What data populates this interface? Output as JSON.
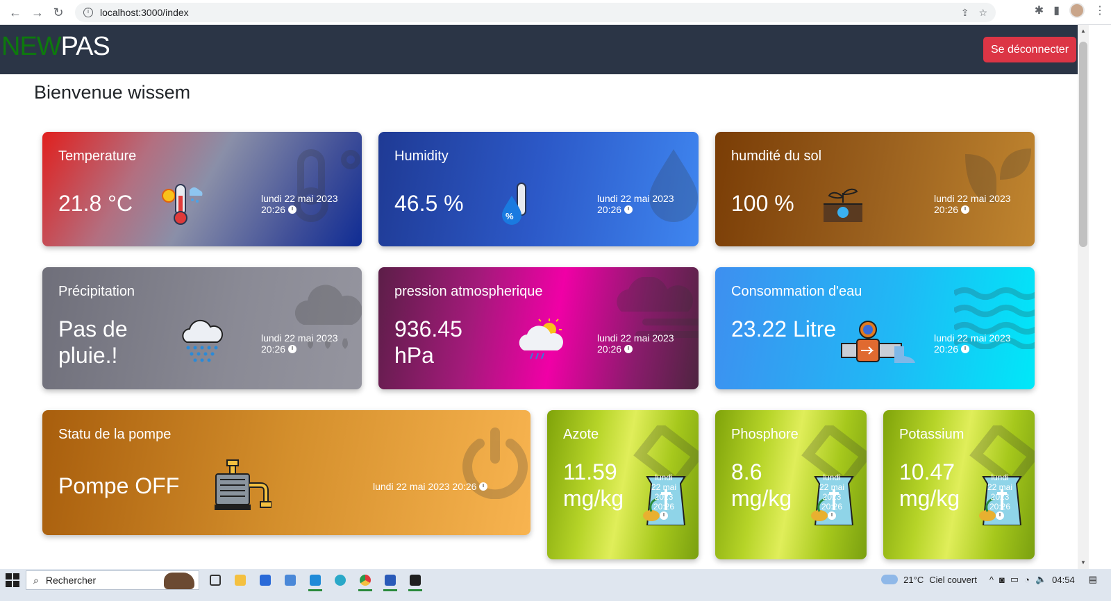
{
  "browser": {
    "url": "localhost:3000/index",
    "icons": [
      "back-arrow-icon",
      "forward-arrow-icon",
      "reload-icon",
      "info-icon",
      "share-icon",
      "star-icon",
      "extensions-icon",
      "side-panel-icon",
      "profile-avatar",
      "more-menu-icon"
    ]
  },
  "header": {
    "logo_part1": "NEW",
    "logo_part2": "PAS",
    "logo_part1_color": "#0d7a0d",
    "logout_label": "Se déconnecter",
    "logout_color": "#dc3545"
  },
  "welcome": "Bienvenue wissem",
  "cards": {
    "temperature": {
      "title": "Temperature",
      "value": "21.8 °C",
      "date": "lundi 22 mai 2023",
      "time": "20:26",
      "icon": "thermometer-sun-icon",
      "bg_icon": "thermometer-icon"
    },
    "humidity": {
      "title": "Humidity",
      "value": "46.5 %",
      "date": "lundi 22 mai 2023",
      "time": "20:26",
      "icon": "humidity-drop-icon",
      "bg_icon": "droplet-icon"
    },
    "soil": {
      "title": "humdité du sol",
      "value": "100 %",
      "date": "lundi 22 mai 2023",
      "time": "20:26",
      "icon": "plant-soil-icon",
      "bg_icon": "seedling-icon"
    },
    "precipitation": {
      "title": "Précipitation",
      "value_line1": "Pas de",
      "value_line2": "pluie.!",
      "date": "lundi 22 mai 2023",
      "time": "20:26",
      "icon": "rain-cloud-icon",
      "bg_icon": "cloud-rain-icon"
    },
    "pressure": {
      "title": "pression atmospherique",
      "value_line1": "936.45",
      "value_line2": "hPa",
      "date": "lundi 22 mai 2023",
      "time": "20:26",
      "icon": "cloud-sun-rain-icon",
      "bg_icon": "smog-icon"
    },
    "water": {
      "title": "Consommation d'eau",
      "value": "23.22 Litre",
      "date": "lundi 22 mai 2023",
      "time": "20:26",
      "icon": "water-meter-pipe-icon",
      "bg_icon": "water-waves-icon"
    },
    "pump": {
      "title": "Statu de la pompe",
      "value": "Pompe OFF",
      "date": "lundi 22 mai 2023 20:26",
      "icon": "water-pump-icon",
      "bg_icon": "power-icon"
    },
    "azote": {
      "title": "Azote",
      "value_line1": "11.59",
      "value_line2": "mg/kg",
      "date_l1": "lundi",
      "date_l2": "22 mai",
      "date_l3": "2023",
      "date_l4": "20:26",
      "icon": "fertilizer-bag-icon",
      "bg_icon": "flask-icon"
    },
    "phosphore": {
      "title": "Phosphore",
      "value_line1": "8.6",
      "value_line2": "mg/kg",
      "date_l1": "lundi",
      "date_l2": "22 mai",
      "date_l3": "2023",
      "date_l4": "20:26",
      "icon": "fertilizer-bag-icon",
      "bg_icon": "flask-icon"
    },
    "potassium": {
      "title": "Potassium",
      "value_line1": "10.47",
      "value_line2": "mg/kg",
      "date_l1": "lundi",
      "date_l2": "22 mai",
      "date_l3": "2023",
      "date_l4": "20:26",
      "icon": "fertilizer-bag-icon",
      "bg_icon": "flask-icon"
    }
  },
  "taskbar": {
    "search_placeholder": "Rechercher",
    "weather_temp": "21°C",
    "weather_desc": "Ciel couvert",
    "clock": "04:54"
  }
}
